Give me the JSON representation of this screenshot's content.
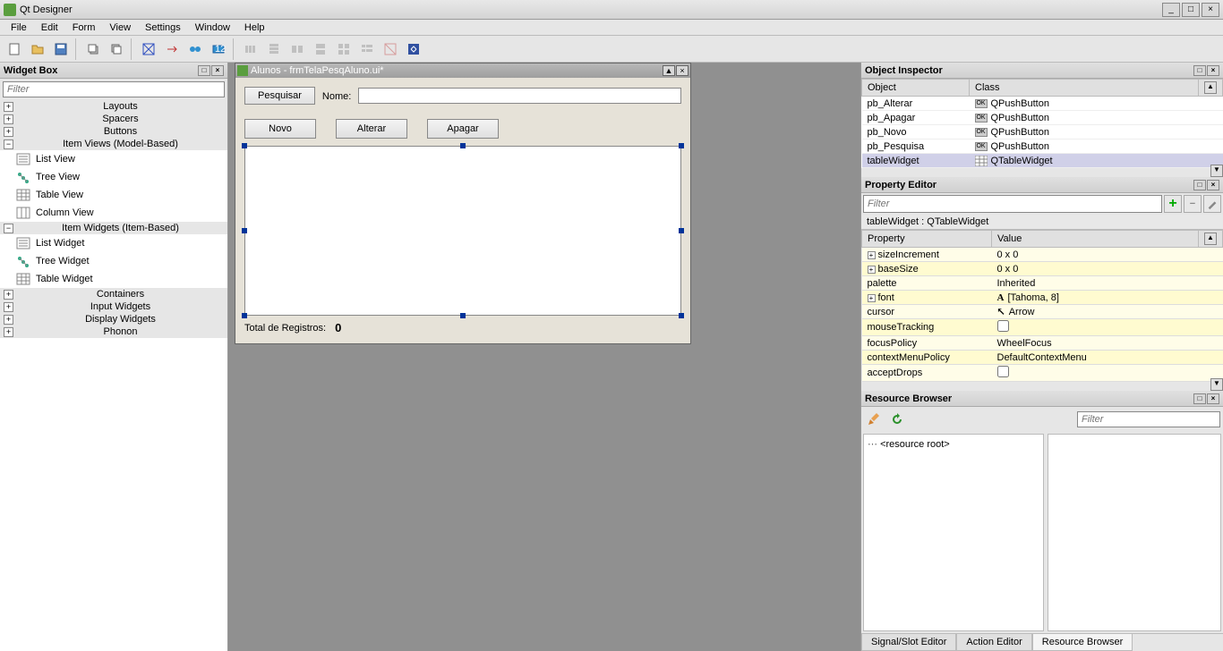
{
  "app": {
    "title": "Qt Designer"
  },
  "menu": [
    "File",
    "Edit",
    "Form",
    "View",
    "Settings",
    "Window",
    "Help"
  ],
  "widgetbox": {
    "title": "Widget Box",
    "filter_placeholder": "Filter",
    "categories": [
      {
        "label": "Layouts",
        "expanded": false,
        "items": []
      },
      {
        "label": "Spacers",
        "expanded": false,
        "items": []
      },
      {
        "label": "Buttons",
        "expanded": false,
        "items": []
      },
      {
        "label": "Item Views (Model-Based)",
        "expanded": true,
        "items": [
          "List View",
          "Tree View",
          "Table View",
          "Column View"
        ]
      },
      {
        "label": "Item Widgets (Item-Based)",
        "expanded": true,
        "items": [
          "List Widget",
          "Tree Widget",
          "Table Widget"
        ]
      },
      {
        "label": "Containers",
        "expanded": false,
        "items": []
      },
      {
        "label": "Input Widgets",
        "expanded": false,
        "items": []
      },
      {
        "label": "Display Widgets",
        "expanded": false,
        "items": []
      },
      {
        "label": "Phonon",
        "expanded": false,
        "items": []
      }
    ]
  },
  "form": {
    "title": "Alunos - frmTelaPesqAluno.ui*",
    "btn_pesquisar": "Pesquisar",
    "lbl_nome": "Nome:",
    "btn_novo": "Novo",
    "btn_alterar": "Alterar",
    "btn_apagar": "Apagar",
    "footer_label": "Total de Registros:",
    "footer_value": "0"
  },
  "inspector": {
    "title": "Object Inspector",
    "cols": [
      "Object",
      "Class"
    ],
    "rows": [
      {
        "obj": "pb_Alterar",
        "cls": "QPushButton"
      },
      {
        "obj": "pb_Apagar",
        "cls": "QPushButton"
      },
      {
        "obj": "pb_Novo",
        "cls": "QPushButton"
      },
      {
        "obj": "pb_Pesquisa",
        "cls": "QPushButton"
      },
      {
        "obj": "tableWidget",
        "cls": "QTableWidget",
        "sel": true
      }
    ]
  },
  "properties": {
    "title": "Property Editor",
    "filter_placeholder": "Filter",
    "class_line": "tableWidget : QTableWidget",
    "cols": [
      "Property",
      "Value"
    ],
    "rows": [
      {
        "p": "sizeIncrement",
        "v": "0 x 0",
        "exp": true
      },
      {
        "p": "baseSize",
        "v": "0 x 0",
        "exp": true
      },
      {
        "p": "palette",
        "v": "Inherited"
      },
      {
        "p": "font",
        "v": "[Tahoma, 8]",
        "exp": true,
        "icon": "A"
      },
      {
        "p": "cursor",
        "v": "Arrow",
        "icon": "↖"
      },
      {
        "p": "mouseTracking",
        "v": "",
        "check": true
      },
      {
        "p": "focusPolicy",
        "v": "WheelFocus"
      },
      {
        "p": "contextMenuPolicy",
        "v": "DefaultContextMenu"
      },
      {
        "p": "acceptDrops",
        "v": "",
        "check": true
      }
    ]
  },
  "resource": {
    "title": "Resource Browser",
    "filter_placeholder": "Filter",
    "root": "<resource root>",
    "tabs": [
      "Signal/Slot Editor",
      "Action Editor",
      "Resource Browser"
    ]
  }
}
